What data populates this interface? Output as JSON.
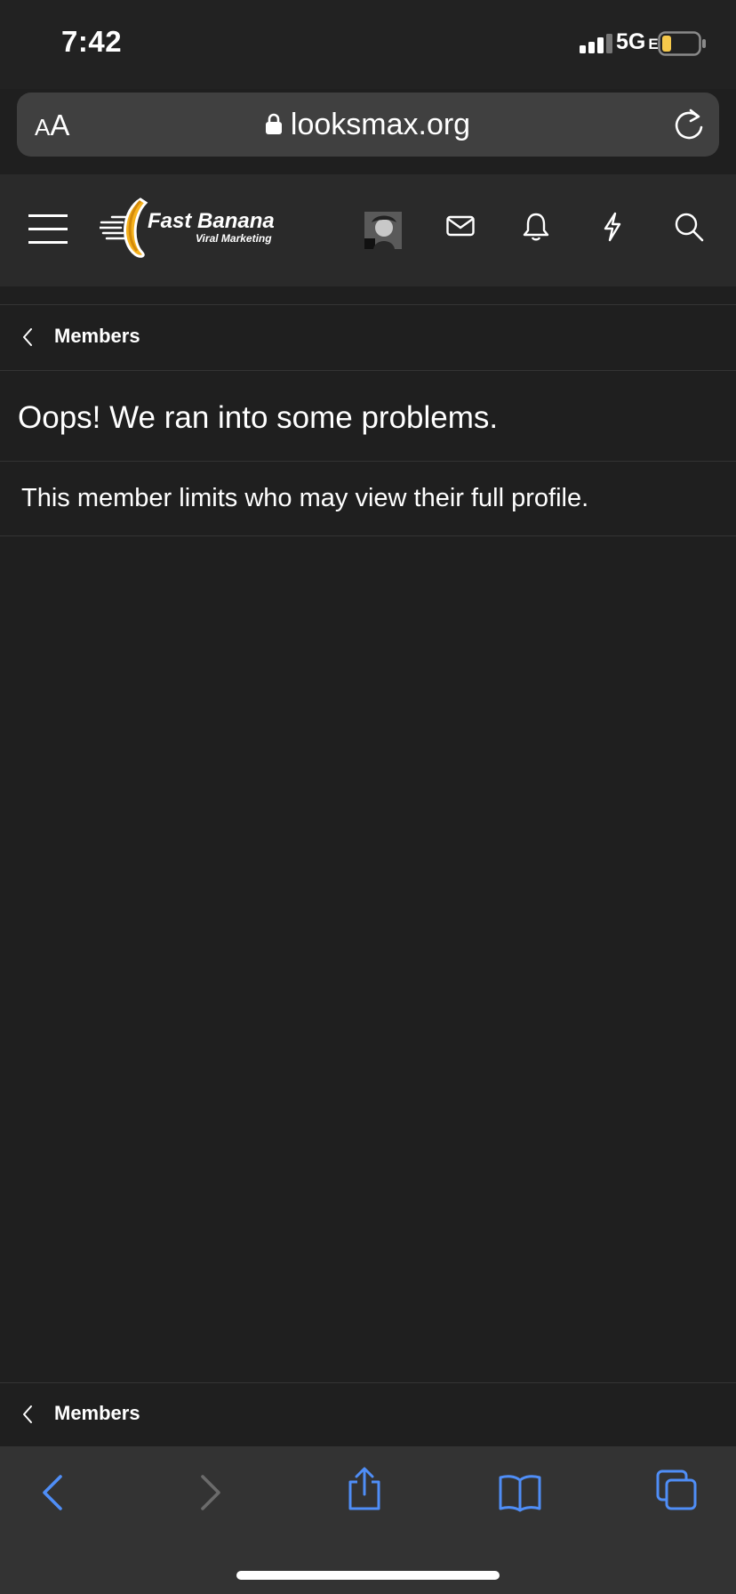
{
  "status_bar": {
    "time": "7:42",
    "network": "5G",
    "network_suffix": "E",
    "battery_color": "#f5c84b"
  },
  "browser": {
    "text_size_label_small": "A",
    "text_size_label_large": "A",
    "url": "looksmax.org"
  },
  "header": {
    "logo_title": "Fast Banana",
    "logo_subtitle": "Viral Marketing",
    "icons": [
      "menu-icon",
      "avatar",
      "mail-icon",
      "bell-icon",
      "bolt-icon",
      "search-icon"
    ]
  },
  "breadcrumb_top": {
    "label": "Members"
  },
  "main": {
    "title": "Oops! We ran into some problems.",
    "message": "This member limits who may view their full profile."
  },
  "breadcrumb_bottom": {
    "label": "Members"
  },
  "toolbar": {
    "accent_color": "#4f8ef7",
    "icons": [
      "back-icon",
      "forward-icon",
      "share-icon",
      "bookmarks-icon",
      "tabs-icon"
    ]
  }
}
